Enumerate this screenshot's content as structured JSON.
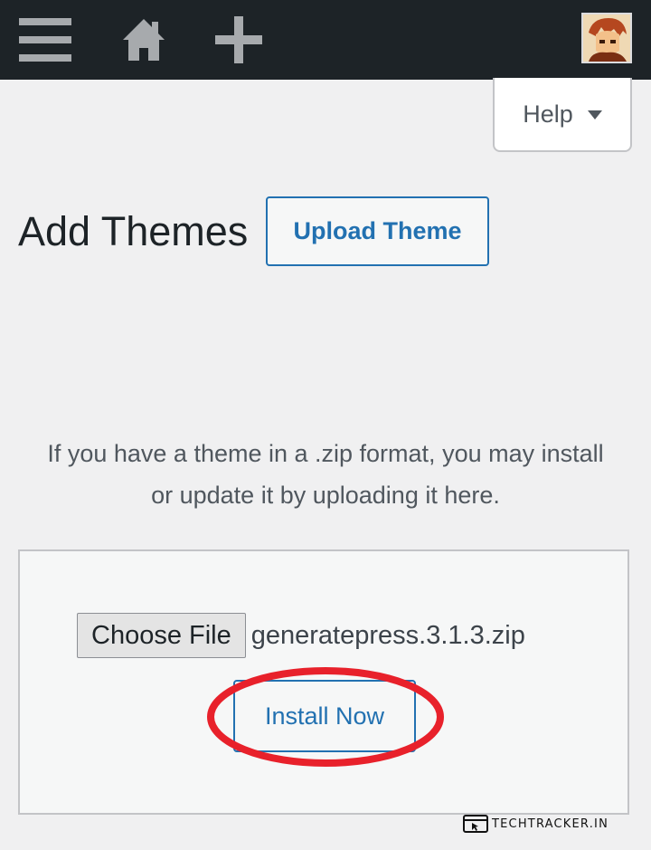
{
  "admin_bar": {
    "icons": {
      "menu": "menu-icon",
      "home": "home-icon",
      "add": "plus-icon",
      "avatar": "user-avatar"
    },
    "background": "#1d2327",
    "icon_color": "#a7aaad"
  },
  "help_tab": {
    "label": "Help",
    "icon": "caret-down-icon"
  },
  "page": {
    "title": "Add Themes",
    "upload_button_label": "Upload Theme"
  },
  "upload": {
    "description": "If you have a theme in a .zip format, you may install or update it by uploading it here.",
    "choose_file_label": "Choose File",
    "selected_file": "generatepress.3.1.3.zip",
    "install_button_label": "Install Now"
  },
  "annotation": {
    "highlight_color": "#e8212b",
    "highlight_target": "Install Now"
  },
  "watermark": {
    "text": "TECHTRACKER.IN",
    "icon": "browser-cursor-icon"
  },
  "colors": {
    "accent": "#2271b1",
    "page_background": "#f0f0f1"
  }
}
